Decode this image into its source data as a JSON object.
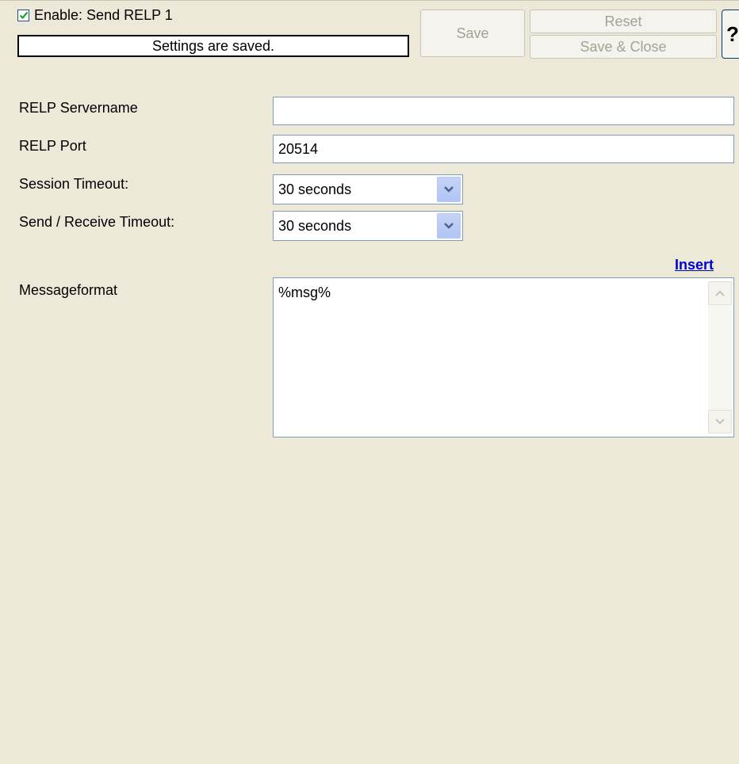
{
  "header": {
    "enable_label": "Enable: Send RELP 1",
    "enable_checked": true,
    "status": "Settings are saved."
  },
  "toolbar": {
    "save_label": "Save",
    "reset_label": "Reset",
    "save_close_label": "Save & Close",
    "help_label": "?"
  },
  "form": {
    "servername": {
      "label": "RELP Servername",
      "value": ""
    },
    "port": {
      "label": "RELP Port",
      "value": "20514"
    },
    "session_timeout": {
      "label": "Session Timeout:",
      "value": "30 seconds"
    },
    "sendrecv_timeout": {
      "label": "Send / Receive Timeout:",
      "value": "30 seconds"
    },
    "insert_link": "Insert",
    "messageformat": {
      "label": "Messageformat",
      "value": "%msg%"
    }
  },
  "colors": {
    "background": "#ece9d8",
    "link": "#0000cc",
    "checkbox_check": "#21a121",
    "input_border": "#7f9db9"
  },
  "icons": {
    "checkbox": "checkmark-icon",
    "dropdown": "chevron-down-icon",
    "scroll_up": "arrow-up-icon",
    "scroll_down": "arrow-down-icon"
  }
}
